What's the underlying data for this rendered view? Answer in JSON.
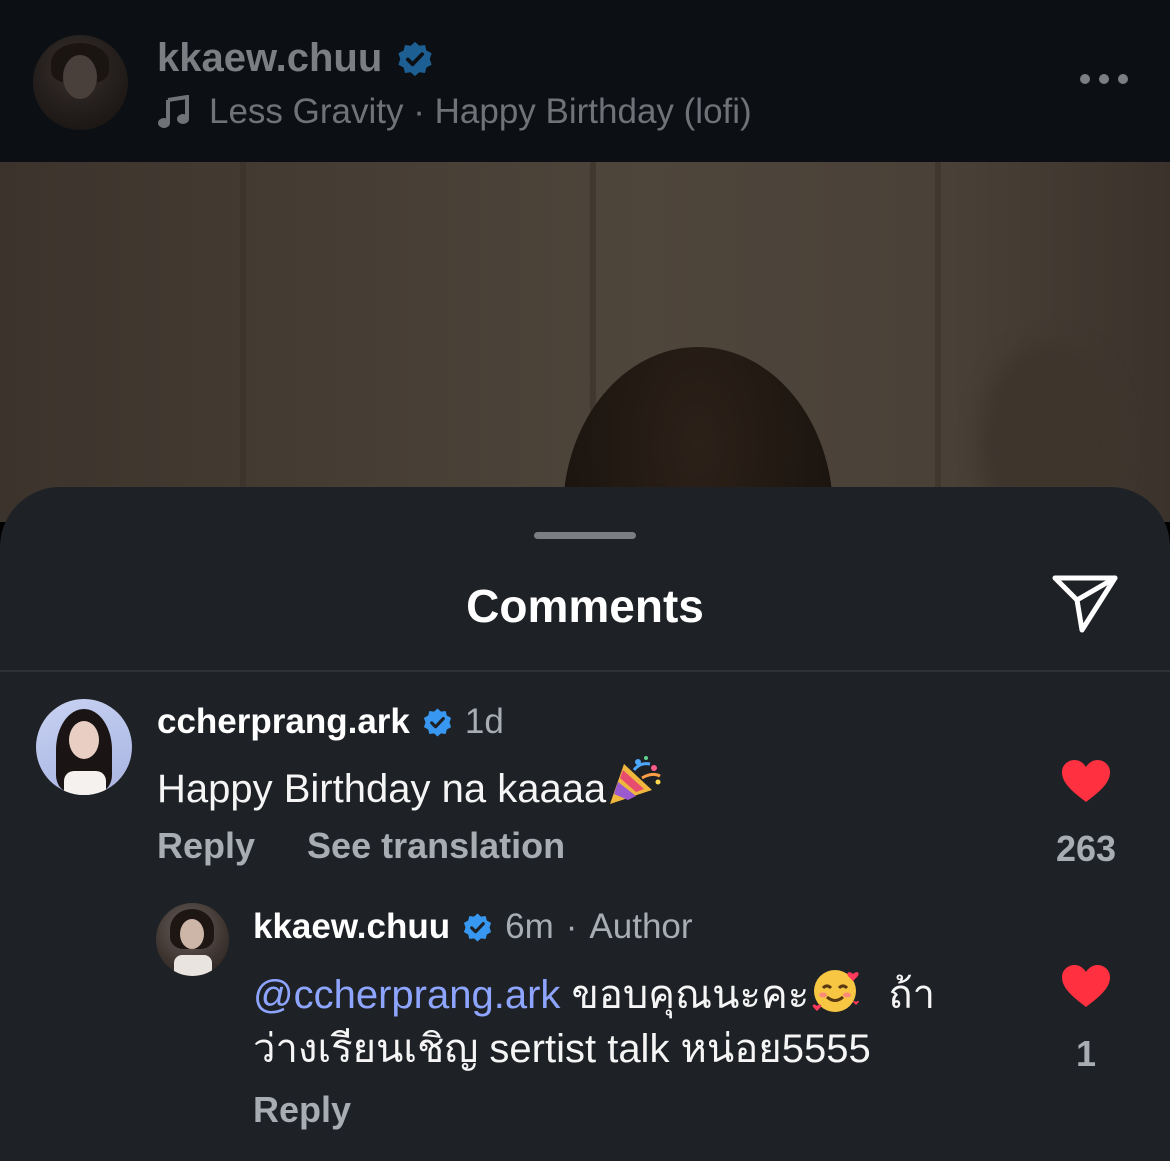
{
  "header": {
    "username": "kkaew.chuu",
    "music_artist": "Less Gravity",
    "music_separator": "·",
    "music_title": "Happy Birthday (lofi)"
  },
  "sheet": {
    "title": "Comments"
  },
  "comments": [
    {
      "username": "ccherprang.ark",
      "time": "1d",
      "text": "Happy Birthday na kaaaa",
      "reply_label": "Reply",
      "translate_label": "See translation",
      "likes": "263"
    }
  ],
  "reply": {
    "username": "kkaew.chuu",
    "time": "6m",
    "separator": "·",
    "role": "Author",
    "mention": "@ccherprang.ark",
    "text_line1": "ขอบคุณนะคะ",
    "text_line1_tail": "ถ้า",
    "text_line2": "ว่างเรียนเชิญ sertist talk หน่อย5555",
    "reply_label": "Reply",
    "likes": "1"
  },
  "colors": {
    "accent_blue": "#3897f0",
    "like_red": "#ff3040",
    "mention": "#8ea5ff",
    "sheet_bg": "#1e2125"
  }
}
